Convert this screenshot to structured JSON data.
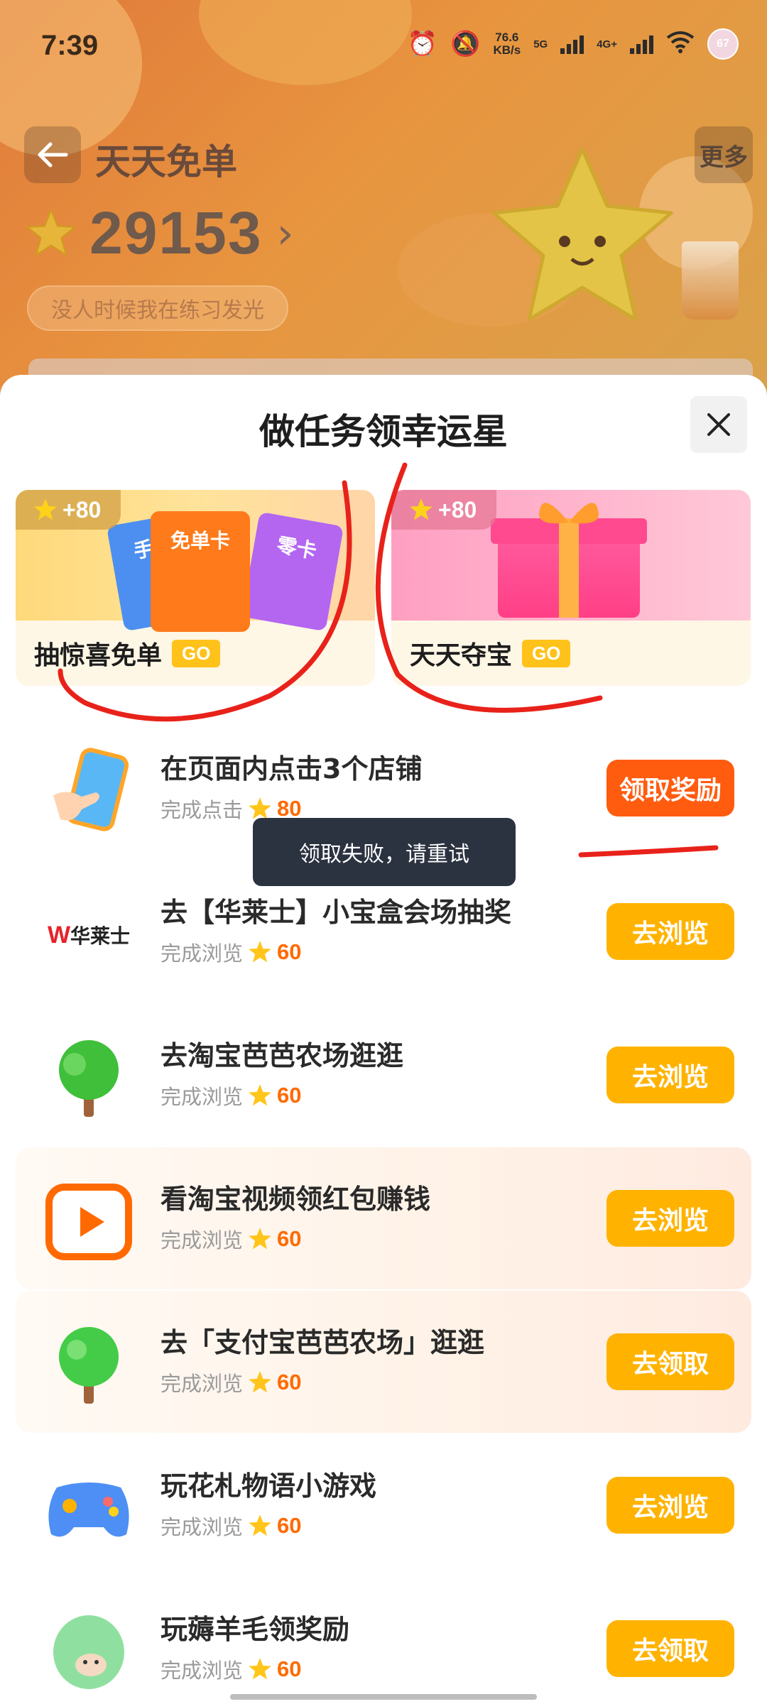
{
  "status_bar": {
    "time": "7:39",
    "net_speed_value": "76.6",
    "net_speed_unit": "KB/s",
    "sig1": "5G",
    "sig2": "4G+",
    "avatar_text": "67"
  },
  "header": {
    "title": "天天免单",
    "more_label": "更多",
    "star_count": "29153",
    "motto": "没人时候我在练习发光"
  },
  "sheet": {
    "title": "做任务领幸运星",
    "promos": [
      {
        "badge": "+80",
        "label": "抽惊喜免单",
        "go": "GO",
        "cards": [
          "手零",
          "免单卡",
          "零卡"
        ]
      },
      {
        "badge": "+80",
        "label": "天天夺宝",
        "go": "GO"
      }
    ],
    "tasks": [
      {
        "title": "在页面内点击3个店铺",
        "sub": "完成点击",
        "points": "80",
        "button": "领取奖励"
      },
      {
        "title": "去【华莱士】小宝盒会场抽奖",
        "sub": "完成浏览",
        "points": "60",
        "button": "去浏览",
        "logo": "华莱士"
      },
      {
        "title": "去淘宝芭芭农场逛逛",
        "sub": "完成浏览",
        "points": "60",
        "button": "去浏览"
      },
      {
        "title": "看淘宝视频领红包赚钱",
        "sub": "完成浏览",
        "points": "60",
        "button": "去浏览"
      },
      {
        "title": "去「支付宝芭芭农场」逛逛",
        "sub": "完成浏览",
        "points": "60",
        "button": "去领取"
      },
      {
        "title": "玩花札物语小游戏",
        "sub": "完成浏览",
        "points": "60",
        "button": "去浏览"
      },
      {
        "title": "玩薅羊毛领奖励",
        "sub": "完成浏览",
        "points": "60",
        "button": "去领取"
      }
    ],
    "toast": "领取失败，请重试"
  },
  "colors": {
    "accent_orange": "#ffb300",
    "claim_red": "#ff5c10",
    "points": "#ff6a00",
    "annotation_red": "#e8221a"
  }
}
